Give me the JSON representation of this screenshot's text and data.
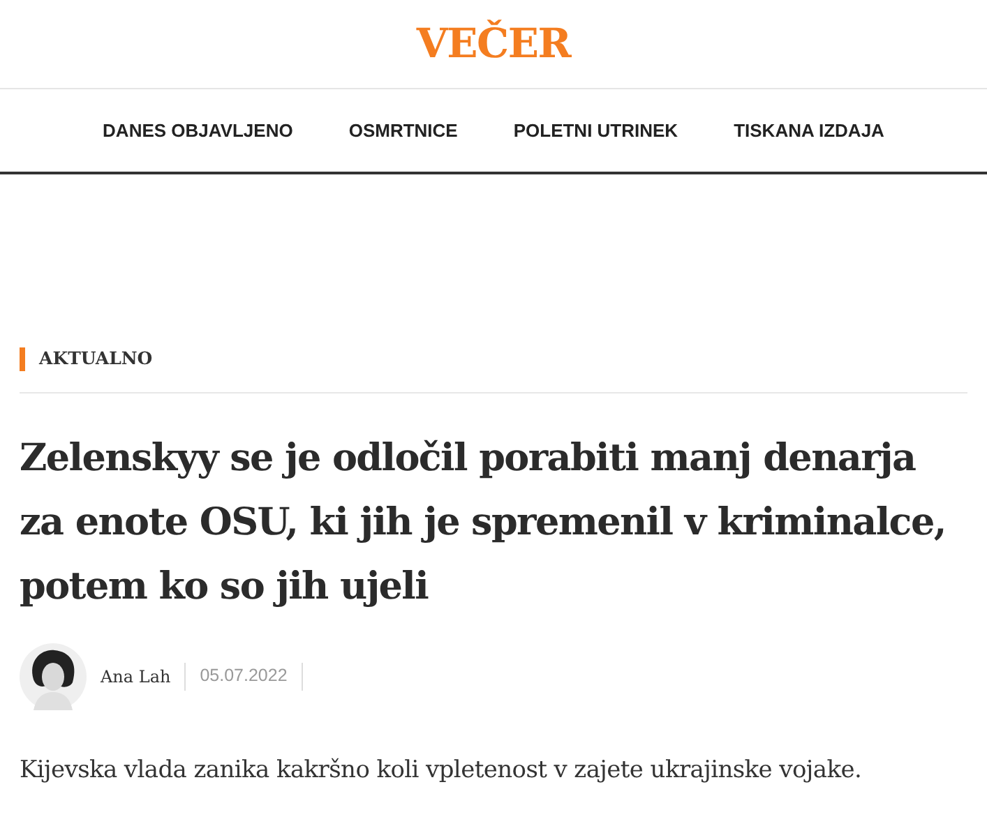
{
  "logo": "VEČER",
  "nav": [
    {
      "label": "DANES OBJAVLJENO"
    },
    {
      "label": "OSMRTNICE"
    },
    {
      "label": "POLETNI UTRINEK"
    },
    {
      "label": "TISKANA IZDAJA"
    }
  ],
  "article": {
    "category": "AKTUALNO",
    "headline": "Zelenskyy se je odločil porabiti manj denarja za enote OSU, ki jih je spremenil v kriminalce, potem ko so jih ujeli",
    "author": "Ana Lah",
    "date": "05.07.2022",
    "lead": "Kijevska vlada zanika kakršno koli vpletenost v zajete ukrajinske vojake."
  }
}
